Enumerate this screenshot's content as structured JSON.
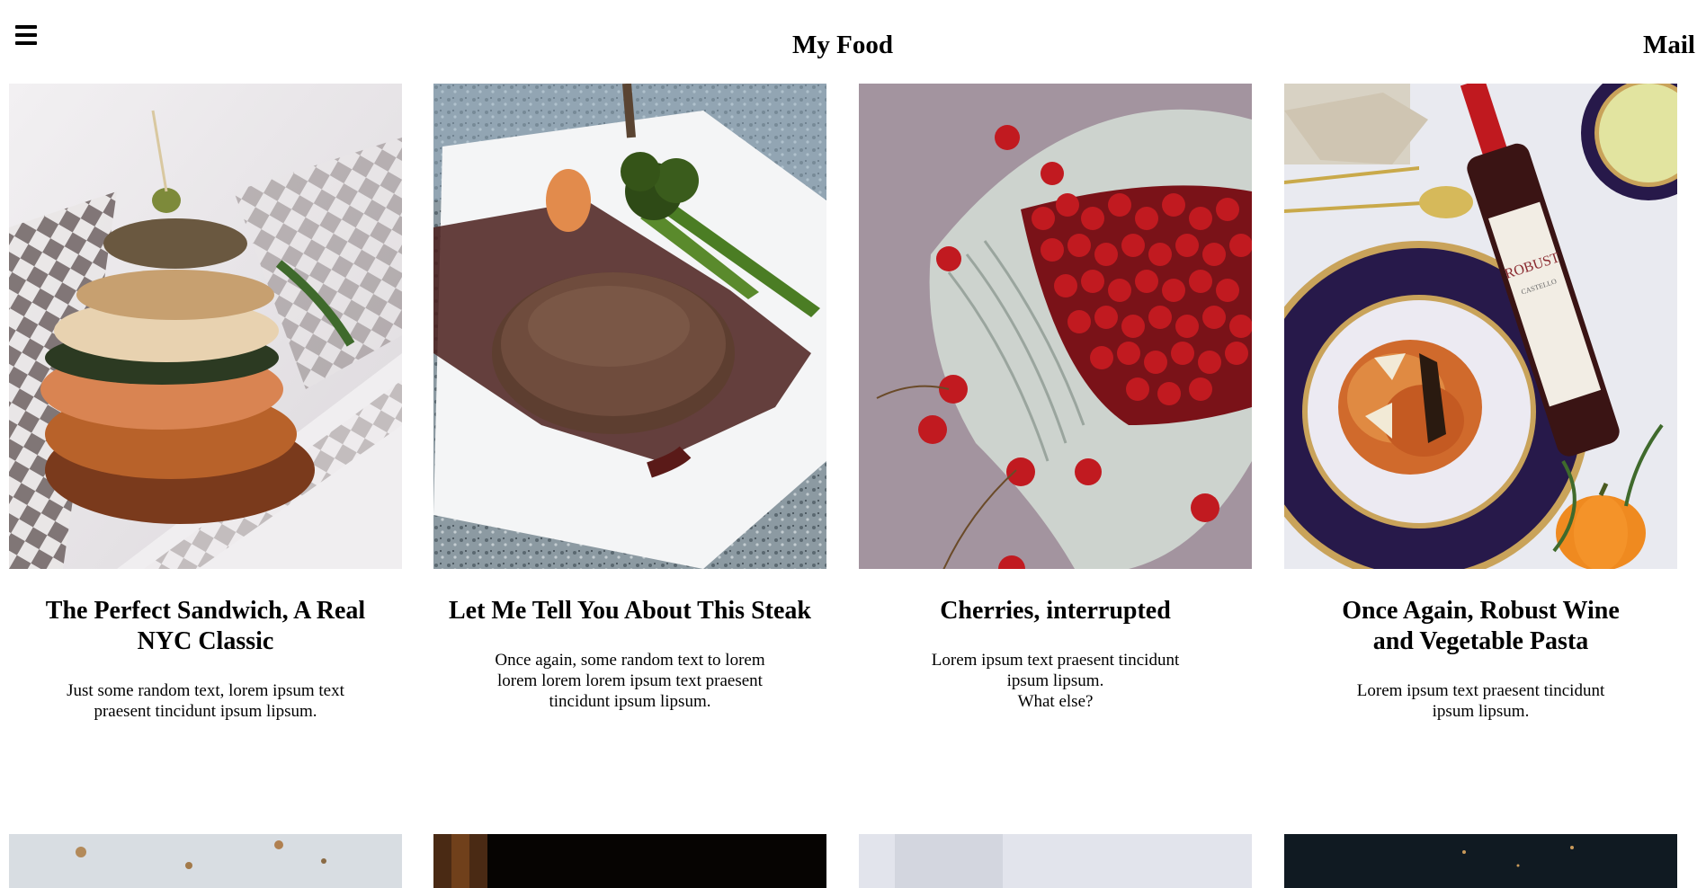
{
  "header": {
    "menu_icon": "hamburger-menu-icon",
    "title": "My Food",
    "mail_label": "Mail"
  },
  "cards": [
    {
      "title": "The Perfect Sandwich, A Real NYC Classic",
      "text": "Just some random text, lorem ipsum text praesent tincidunt ipsum lipsum."
    },
    {
      "title": "Let Me Tell You About This Steak",
      "text": "Once again, some random text to lorem lorem lorem lorem ipsum text praesent tincidunt ipsum lipsum."
    },
    {
      "title": "Cherries, interrupted",
      "text": "Lorem ipsum text praesent tincidunt ipsum lipsum.\nWhat else?"
    },
    {
      "title": "Once Again, Robust Wine and Vegetable Pasta",
      "text": "Lorem ipsum text praesent tincidunt ipsum lipsum."
    }
  ],
  "bottle_label": {
    "brand": "ROBUST",
    "sub": "CASTELLO"
  }
}
